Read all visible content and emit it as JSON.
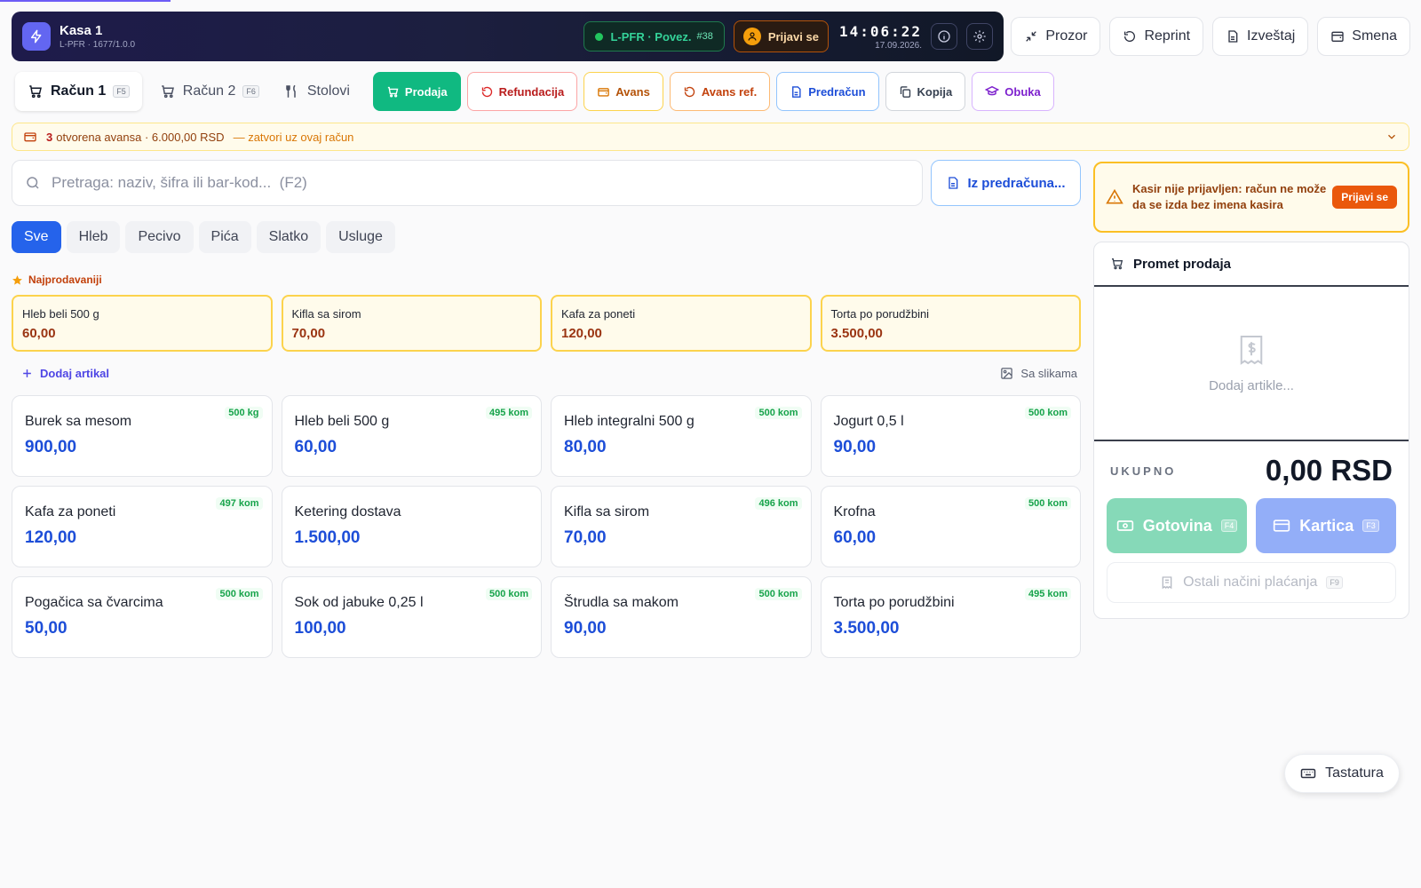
{
  "header": {
    "title": "Kasa 1",
    "subtitle": "L-PFR · 1677/1.0.0",
    "connection": {
      "label": "L-PFR · Povez.",
      "number": "#38"
    },
    "login_label": "Prijavi se",
    "time": "14:06:22",
    "date": "17.09.2026."
  },
  "top_actions": [
    {
      "label": "Prozor",
      "icon": "minimize-icon"
    },
    {
      "label": "Reprint",
      "icon": "reprint-icon"
    },
    {
      "label": "Izveštaj",
      "icon": "report-icon"
    },
    {
      "label": "Smena",
      "icon": "shift-icon"
    }
  ],
  "tabs": [
    {
      "label": "Račun 1",
      "key": "F5",
      "active": true
    },
    {
      "label": "Račun 2",
      "key": "F6",
      "active": false
    },
    {
      "label": "Stolovi",
      "key": "",
      "active": false
    }
  ],
  "modes": [
    {
      "label": "Prodaja",
      "icon": "cart-icon",
      "color": "#10b981",
      "active": true
    },
    {
      "label": "Refundacija",
      "icon": "undo-icon",
      "color": "#dc2626"
    },
    {
      "label": "Avans",
      "icon": "wallet-icon",
      "color": "#d97706"
    },
    {
      "label": "Avans ref.",
      "icon": "undo-icon",
      "color": "#c2410c"
    },
    {
      "label": "Predračun",
      "icon": "document-icon",
      "color": "#1d4ed8"
    },
    {
      "label": "Kopija",
      "icon": "copy-icon",
      "color": "#374151"
    },
    {
      "label": "Obuka",
      "icon": "graduation-icon",
      "color": "#7e22ce"
    }
  ],
  "advance": {
    "count": "3",
    "text": "otvorena avansa · 6.000,00 RSD",
    "link": "— zatvori uz ovaj račun"
  },
  "search": {
    "placeholder": "Pretraga: naziv, šifra ili bar-kod...  (F2)",
    "from_proforma": "Iz predračuna..."
  },
  "categories": [
    {
      "label": "Sve",
      "active": true
    },
    {
      "label": "Hleb"
    },
    {
      "label": "Pecivo"
    },
    {
      "label": "Pića"
    },
    {
      "label": "Slatko"
    },
    {
      "label": "Usluge"
    }
  ],
  "bestsellers": {
    "title": "Najprodavaniji",
    "items": [
      {
        "name": "Hleb beli 500 g",
        "price": "60,00"
      },
      {
        "name": "Kifla sa sirom",
        "price": "70,00"
      },
      {
        "name": "Kafa za poneti",
        "price": "120,00"
      },
      {
        "name": "Torta po porudžbini",
        "price": "3.500,00"
      }
    ]
  },
  "add_item_label": "Dodaj artikal",
  "with_images_label": "Sa slikama",
  "products": [
    {
      "name": "Burek sa mesom",
      "price": "900,00",
      "stock": "500 kg"
    },
    {
      "name": "Hleb beli 500 g",
      "price": "60,00",
      "stock": "495 kom"
    },
    {
      "name": "Hleb integralni 500 g",
      "price": "80,00",
      "stock": "500 kom"
    },
    {
      "name": "Jogurt 0,5 l",
      "price": "90,00",
      "stock": "500 kom"
    },
    {
      "name": "Kafa za poneti",
      "price": "120,00",
      "stock": "497 kom"
    },
    {
      "name": "Ketering dostava",
      "price": "1.500,00",
      "stock": ""
    },
    {
      "name": "Kifla sa sirom",
      "price": "70,00",
      "stock": "496 kom"
    },
    {
      "name": "Krofna",
      "price": "60,00",
      "stock": "500 kom"
    },
    {
      "name": "Pogačica sa čvarcima",
      "price": "50,00",
      "stock": "500 kom"
    },
    {
      "name": "Sok od jabuke 0,25 l",
      "price": "100,00",
      "stock": "500 kom"
    },
    {
      "name": "Štrudla sa makom",
      "price": "90,00",
      "stock": "500 kom"
    },
    {
      "name": "Torta po porudžbini",
      "price": "3.500,00",
      "stock": "495 kom"
    }
  ],
  "warning": {
    "text": "Kasir nije prijavljen: račun ne može da se izda bez imena kasira",
    "button": "Prijavi se"
  },
  "cart": {
    "title": "Promet prodaja",
    "empty_text": "Dodaj artikle...",
    "total_label": "UKUPNO",
    "total_value": "0,00 RSD",
    "cash_label": "Gotovina",
    "cash_key": "F4",
    "card_label": "Kartica",
    "card_key": "F3",
    "other_label": "Ostali načini plaćanja",
    "other_key": "F9"
  },
  "keyboard_label": "Tastatura"
}
